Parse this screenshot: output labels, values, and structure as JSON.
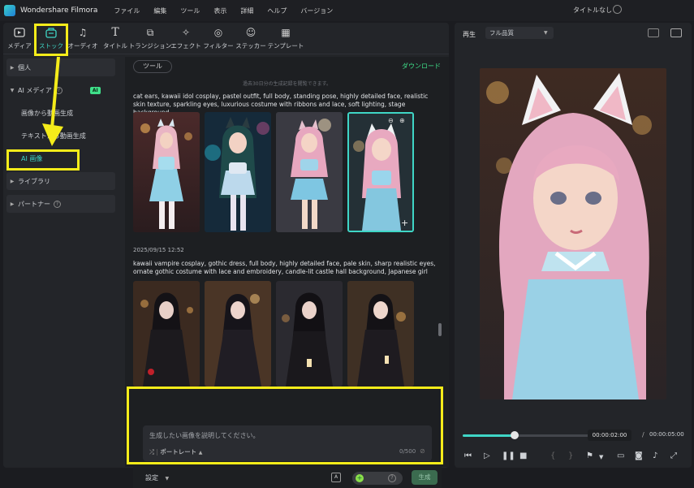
{
  "app": {
    "name": "Wondershare Filmora",
    "document_title": "タイトルなし"
  },
  "menu": [
    "ファイル",
    "編集",
    "ツール",
    "表示",
    "詳細",
    "ヘルプ",
    "バージョン"
  ],
  "toolbar": [
    {
      "label": "メディア",
      "icon": "media-icon"
    },
    {
      "label": "ストック",
      "icon": "stock-icon",
      "active": true
    },
    {
      "label": "オーディオ",
      "icon": "audio-icon"
    },
    {
      "label": "タイトル",
      "icon": "title-icon"
    },
    {
      "label": "トランジション",
      "icon": "transition-icon"
    },
    {
      "label": "エフェクト",
      "icon": "effect-icon"
    },
    {
      "label": "フィルター",
      "icon": "filter-icon"
    },
    {
      "label": "ステッカー",
      "icon": "sticker-icon"
    },
    {
      "label": "テンプレート",
      "icon": "template-icon"
    }
  ],
  "sidebar": {
    "personal": "個人",
    "ai_media": "AI メディア",
    "ai_badge": "AI",
    "image_to_video": "画像から動画生成",
    "text_to_video": "テキストから動画生成",
    "ai_image": "AI 画像",
    "library": "ライブラリ",
    "partner": "パートナー"
  },
  "content": {
    "tool_pill": "ツール",
    "download": "ダウンロード",
    "notice": "過去30日分の生成記録を閲覧できます。",
    "prompt1": "cat ears, kawaii idol cosplay, pastel outfit, full body, standing pose, highly detailed face, realistic skin texture, sparkling eyes, luxurious costume with ribbons and lace, soft lighting, stage background",
    "date2": "2025/09/15 12:52",
    "prompt2": "kawaii vampire cosplay, gothic dress, full body, highly detailed face, pale skin, sharp realistic eyes, ornate gothic costume with lace and embroidery, candle-lit castle hall background,  Japanese girl"
  },
  "prompt_box": {
    "placeholder": "生成したい画像を説明してください。",
    "mode": "ポートレート",
    "counter": "0/500",
    "settings": "設定",
    "generate": "生成"
  },
  "player": {
    "label": "再生",
    "quality": "フル品質",
    "current_time": "00:00:02:00",
    "separator": "/",
    "total_time": "00:00:05:00",
    "progress": 0.4
  },
  "colors": {
    "accent": "#3fd6c6",
    "highlight": "#f5ec1a",
    "ai_green": "#3fe08a"
  }
}
